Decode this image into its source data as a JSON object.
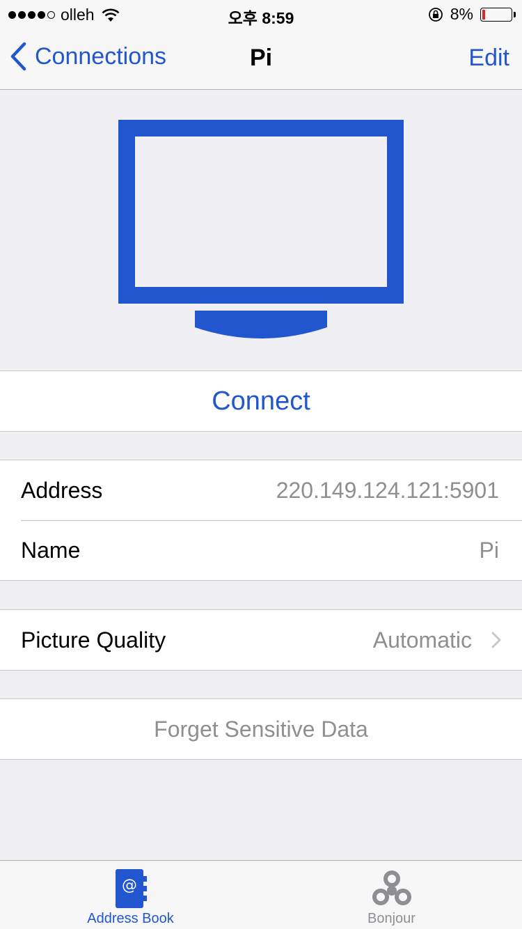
{
  "status_bar": {
    "carrier": "olleh",
    "time": "오후 8:59",
    "battery_percent": "8%",
    "battery_level": 0.08,
    "signal_bars_filled": 4,
    "signal_bars_total": 5
  },
  "nav": {
    "back_label": "Connections",
    "title": "Pi",
    "edit_label": "Edit"
  },
  "connect_label": "Connect",
  "details": {
    "address_label": "Address",
    "address_value": "220.149.124.121:5901",
    "name_label": "Name",
    "name_value": "Pi"
  },
  "quality": {
    "label": "Picture Quality",
    "value": "Automatic"
  },
  "forget_label": "Forget Sensitive Data",
  "tabs": [
    {
      "label": "Address Book",
      "icon": "address-book-icon",
      "active": true
    },
    {
      "label": "Bonjour",
      "icon": "bonjour-icon",
      "active": false
    }
  ],
  "colors": {
    "accent": "#2256cf",
    "background": "#efeff4",
    "secondary_text": "#8e8e93",
    "battery_low": "#e0262c"
  }
}
